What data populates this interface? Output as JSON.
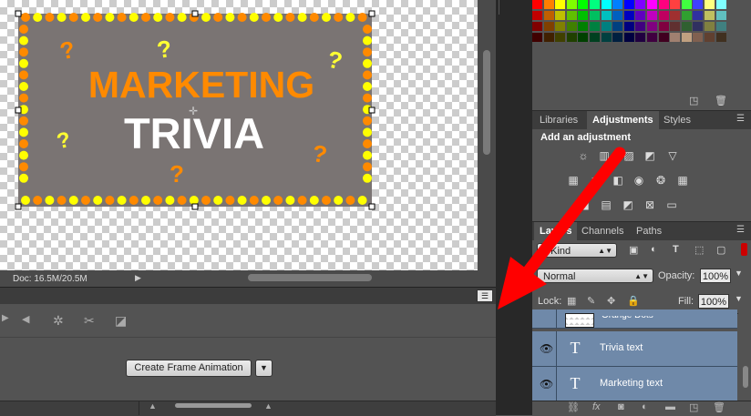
{
  "canvas": {
    "title_line1": "MARKETING",
    "title_line2": "TRIVIA",
    "question_mark": "?",
    "doc_info": "Doc: 16.5M/20.5M",
    "bg_color": "#7a7473",
    "accent_orange": "#ff8a00",
    "accent_yellow": "#ffff00"
  },
  "timeline": {
    "create_button": "Create Frame Animation"
  },
  "adjustments": {
    "tabs": [
      "Libraries",
      "Adjustments",
      "Styles"
    ],
    "active_tab": "Adjustments",
    "heading": "Add an adjustment"
  },
  "layers": {
    "tabs": [
      "Layers",
      "Channels",
      "Paths"
    ],
    "kind_label": "Kind",
    "blend_mode": "Normal",
    "opacity_label": "Opacity:",
    "opacity_value": "100%",
    "lock_label": "Lock:",
    "fill_label": "Fill:",
    "fill_value": "100%",
    "items": [
      {
        "name": "Orange Dots"
      },
      {
        "name": "Trivia text"
      },
      {
        "name": "Marketing text"
      }
    ]
  },
  "annotation": {
    "arrow_color": "#ff0000"
  }
}
